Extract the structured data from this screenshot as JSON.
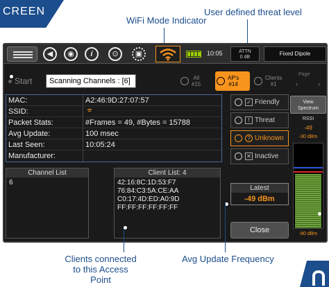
{
  "banner": {
    "text": "CREEN"
  },
  "callouts": {
    "wifi_mode": "WiFi Mode Indicator",
    "threat_level": "User defined threat level",
    "clients_connected_1": "Clients connected",
    "clients_connected_2": "to this Access Point",
    "avg_update": "Avg Update Frequency"
  },
  "toolbar": {
    "time": "10:05",
    "attn_label": "ATTN",
    "attn_value": "0 dB",
    "antenna": "Fixed Dipole",
    "icons": [
      "menu-icon",
      "speaker-icon",
      "camera-icon",
      "info-icon",
      "location-icon",
      "device-icon",
      "wifi-icon",
      "battery-icon"
    ]
  },
  "controls": {
    "start": "Start",
    "scanning": "Scanning Channels : [6]",
    "tabs": [
      {
        "line1": "All",
        "line2": "#15"
      },
      {
        "line1": "AP's",
        "line2": "#14"
      },
      {
        "line1": "Clients",
        "line2": "#1"
      }
    ],
    "page_label": "Page"
  },
  "info": {
    "rows": [
      {
        "key": "MAC:",
        "value": "A2:46:9D:27:07:57"
      },
      {
        "key": "SSID:",
        "value": ""
      },
      {
        "key": "Packet Stats:",
        "value": "#Frames = 49, #Bytes = 15788"
      },
      {
        "key": "Avg Update:",
        "value": "100 msec"
      },
      {
        "key": "Last Seen:",
        "value": "10:05:24"
      },
      {
        "key": "Manufacturer:",
        "value": ""
      }
    ]
  },
  "threat": {
    "options": [
      {
        "label": "Friendly",
        "glyph": "✓"
      },
      {
        "label": "Threat",
        "glyph": "!"
      },
      {
        "label": "Unknown",
        "glyph": "?"
      },
      {
        "label": "Inactive",
        "glyph": "✕"
      }
    ],
    "selected": "Unknown"
  },
  "rssi": {
    "view_line1": "View",
    "view_line2": "Spectrum",
    "label": "RSSI",
    "value": "-49",
    "top_scale": "-30 dBm",
    "bottom_scale": "-80 dBm",
    "level_fraction": 0.64
  },
  "channel_list": {
    "title": "Channel List",
    "items": [
      "6"
    ]
  },
  "client_list": {
    "title": "Client List: 4",
    "items": [
      "42:16:8C:1D:53:F7",
      "76:84:C3:5A:CE:AA",
      "C0:17:4D:ED:A0:9D",
      "FF:FF:FF:FF:FF:FF"
    ]
  },
  "latest": {
    "title": "Latest",
    "value": "-49 dBm"
  },
  "close": "Close",
  "colors": {
    "accent": "#f7941d",
    "brand": "#1c4d8c",
    "meter_green": "#6fa13c"
  }
}
